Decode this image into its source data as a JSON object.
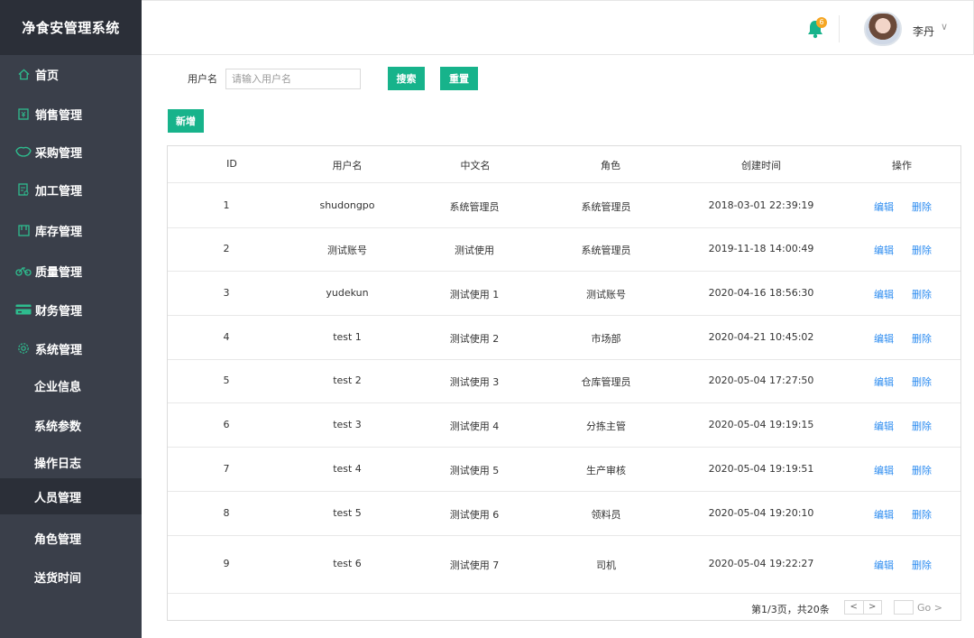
{
  "app": {
    "title": "净食安管理系统"
  },
  "sidebar": {
    "items": [
      {
        "label": "首页",
        "icon": "home-icon"
      },
      {
        "label": "销售管理",
        "icon": "sales-icon"
      },
      {
        "label": "采购管理",
        "icon": "purchase-icon"
      },
      {
        "label": "加工管理",
        "icon": "processing-icon"
      },
      {
        "label": "库存管理",
        "icon": "inventory-icon"
      },
      {
        "label": "质量管理",
        "icon": "quality-icon"
      },
      {
        "label": "财务管理",
        "icon": "finance-icon"
      },
      {
        "label": "系统管理",
        "icon": "settings-icon"
      }
    ],
    "sub_items": [
      {
        "label": "企业信息"
      },
      {
        "label": "系统参数"
      },
      {
        "label": "操作日志"
      },
      {
        "label": "人员管理",
        "active": true
      },
      {
        "label": "角色管理"
      },
      {
        "label": "送货时间"
      }
    ]
  },
  "header": {
    "notification_count": "6",
    "user_name": "李丹",
    "caret": "∨"
  },
  "search": {
    "label": "用户名",
    "placeholder": "请输入用户名",
    "search_button": "搜索",
    "reset_button": "重置",
    "add_button": "新增"
  },
  "table": {
    "columns": [
      "ID",
      "用户名",
      "中文名",
      "角色",
      "创建时间",
      "操作"
    ],
    "edit_label": "编辑",
    "delete_label": "删除",
    "rows": [
      {
        "id": "1",
        "username": "shudongpo",
        "cn_name": "系统管理员",
        "role": "系统管理员",
        "created": "2018-03-01 22:39:19"
      },
      {
        "id": "2",
        "username": "测试账号",
        "cn_name": "测试使用",
        "role": "系统管理员",
        "created": "2019-11-18 14:00:49"
      },
      {
        "id": "3",
        "username": "yudekun",
        "cn_name": "测试使用 1",
        "role": "测试账号",
        "created": "2020-04-16 18:56:30"
      },
      {
        "id": "4",
        "username": "test 1",
        "cn_name": "测试使用 2",
        "role": "市场部",
        "created": "2020-04-21 10:45:02"
      },
      {
        "id": "5",
        "username": "test 2",
        "cn_name": "测试使用 3",
        "role": "仓库管理员",
        "created": "2020-05-04 17:27:50"
      },
      {
        "id": "6",
        "username": "test 3",
        "cn_name": "测试使用 4",
        "role": "分拣主管",
        "created": "2020-05-04 19:19:15"
      },
      {
        "id": "7",
        "username": "test 4",
        "cn_name": "测试使用 5",
        "role": "生产审核",
        "created": "2020-05-04 19:19:51"
      },
      {
        "id": "8",
        "username": "test 5",
        "cn_name": "测试使用 6",
        "role": "领料员",
        "created": "2020-05-04 19:20:10"
      },
      {
        "id": "9",
        "username": "test 6",
        "cn_name": "测试使用 7",
        "role": "司机",
        "created": "2020-05-04 19:22:27"
      }
    ]
  },
  "pagination": {
    "info": "第1/3页，共20条",
    "prev": "<",
    "next": ">",
    "go": "Go >"
  },
  "colors": {
    "accent": "#17b38b",
    "link": "#2d8cf0",
    "sidebar": "#3a3f4a",
    "sidebar_dark": "#2b2f38"
  }
}
